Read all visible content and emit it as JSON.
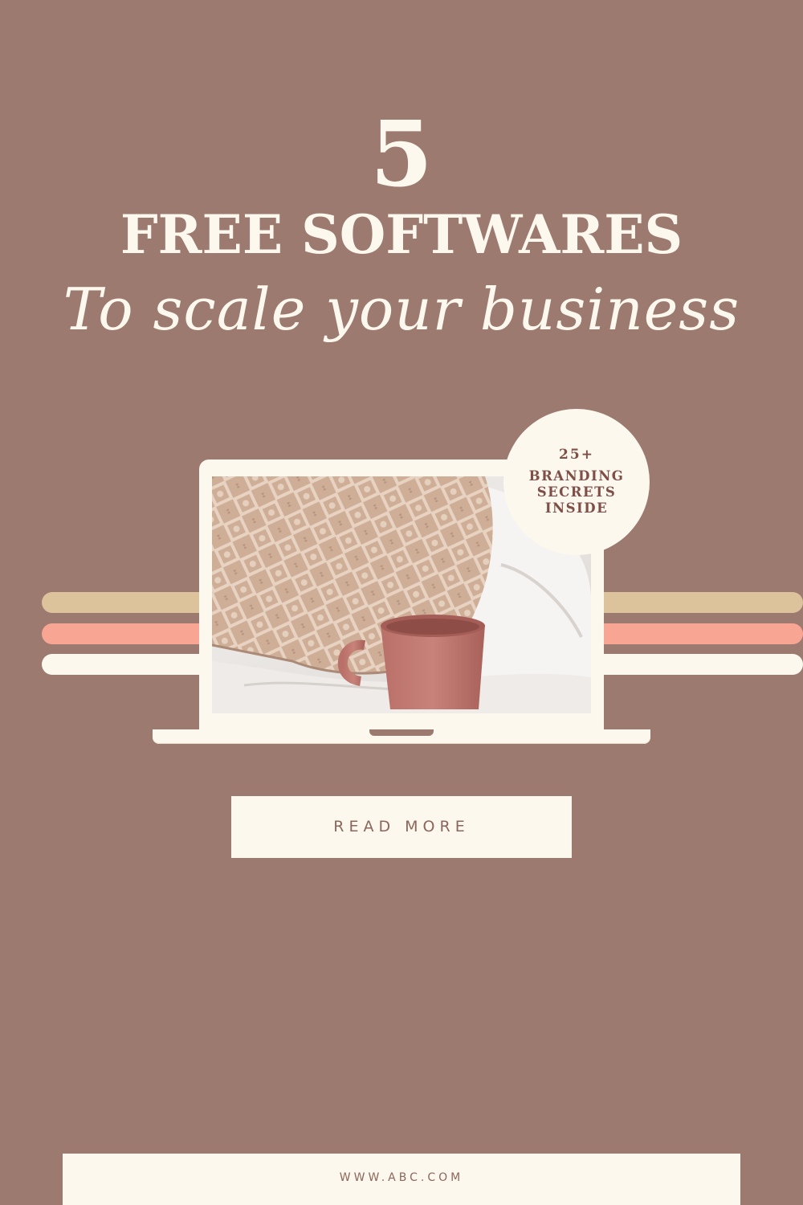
{
  "headline": {
    "number": "5",
    "title": "FREE SOFTWARES",
    "subtitle": "To scale your business"
  },
  "badge": {
    "count": "25+",
    "line1": "BRANDING",
    "line2": "SECRETS",
    "line3": "INSIDE"
  },
  "cta": {
    "label": "READ MORE"
  },
  "footer": {
    "url": "WWW.ABC.COM"
  },
  "colors": {
    "background": "#9c7a6f",
    "cream": "#fcf8ee",
    "tan": "#dcc39c",
    "pink": "#f9a593",
    "badge_text": "#7e4e47"
  },
  "image": {
    "subject": "macrame pillow and pink mug on white bedding"
  }
}
